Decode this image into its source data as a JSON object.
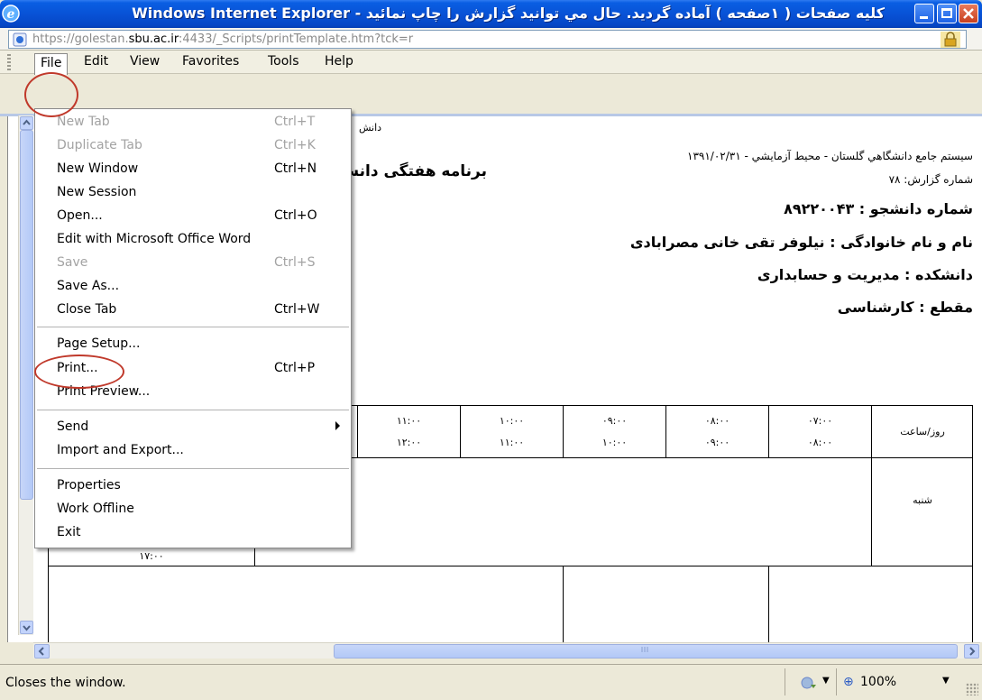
{
  "window": {
    "title": "كليه صفحات ( ۱صفحه ) آماده گرديد. حال مي توانيد گزارش را چاپ نمائيد - Windows Internet Explorer"
  },
  "address": {
    "url_prefix": "https://golestan.",
    "url_domain": "sbu.ac.ir",
    "url_suffix": ":4433/_Scripts/printTemplate.htm?tck=r"
  },
  "menubar": {
    "file": "File",
    "edit": "Edit",
    "view": "View",
    "favorites": "Favorites",
    "tools": "Tools",
    "help": "Help"
  },
  "file_menu": {
    "items": [
      {
        "label": "New Tab",
        "shortcut": "Ctrl+T",
        "enabled": false
      },
      {
        "label": "Duplicate Tab",
        "shortcut": "Ctrl+K",
        "enabled": false
      },
      {
        "label": "New Window",
        "shortcut": "Ctrl+N",
        "enabled": true
      },
      {
        "label": "New Session",
        "shortcut": "",
        "enabled": true
      },
      {
        "label": "Open...",
        "shortcut": "Ctrl+O",
        "enabled": true
      },
      {
        "label": "Edit with Microsoft Office Word",
        "shortcut": "",
        "enabled": true
      },
      {
        "label": "Save",
        "shortcut": "Ctrl+S",
        "enabled": false
      },
      {
        "label": "Save As...",
        "shortcut": "",
        "enabled": true
      },
      {
        "label": "Close Tab",
        "shortcut": "Ctrl+W",
        "enabled": true
      },
      {
        "label": "Page Setup...",
        "shortcut": "",
        "enabled": true
      },
      {
        "label": "Print...",
        "shortcut": "Ctrl+P",
        "enabled": true
      },
      {
        "label": "Print Preview...",
        "shortcut": "",
        "enabled": true
      },
      {
        "label": "Send",
        "shortcut": "",
        "enabled": true
      },
      {
        "label": "Import and Export...",
        "shortcut": "",
        "enabled": true
      },
      {
        "label": "Properties",
        "shortcut": "",
        "enabled": true
      },
      {
        "label": "Work Offline",
        "shortcut": "",
        "enabled": true
      },
      {
        "label": "Exit",
        "shortcut": "",
        "enabled": true
      }
    ]
  },
  "report": {
    "univ_small": "دانش",
    "title": "برنامه هفتگی دانش",
    "system_line": "سيستم جامع دانشگاهي گلستان - محيط آزمايشي - ۱۳۹۱/۰۲/۳۱",
    "report_number": "شماره گزارش: ۷۸",
    "student_number": "شماره دانشجو : ۸۹۲۲۰۰۴۳",
    "student_name": "نام و نام خانوادگی : نیلوفر تقی خانی مصرابادی",
    "faculty": "دانشکده : مدیریت و حسابداری",
    "level": "مقطع : کارشناسی"
  },
  "schedule": {
    "header_label": "روز/ساعت",
    "columns": [
      {
        "from": "۰۷:۰۰",
        "to": "۰۸:۰۰"
      },
      {
        "from": "۰۸:۰۰",
        "to": "۰۹:۰۰"
      },
      {
        "from": "۰۹:۰۰",
        "to": "۱۰:۰۰"
      },
      {
        "from": "۱۰:۰۰",
        "to": "۱۱:۰۰"
      },
      {
        "from": "۱۱:۰۰",
        "to": "۱۲:۰۰"
      }
    ],
    "row_label": "شنبه",
    "partial_time": "۱۷:۰۰"
  },
  "statusbar": {
    "text": "Closes the window.",
    "zoom": "100%"
  }
}
